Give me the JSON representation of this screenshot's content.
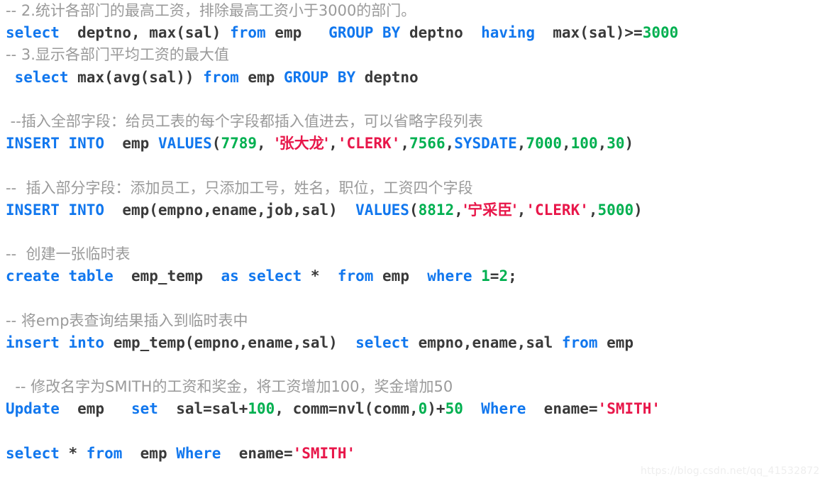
{
  "document": {
    "kind": "sql-code-snippet",
    "language": "SQL",
    "background_color": "#ffffff",
    "watermark": "https://blog.csdn.net/qq_41532872"
  },
  "colors": {
    "keyword": "#1177ee",
    "number": "#00b050",
    "string": "#e8174a",
    "comment": "#9a9a9a",
    "plain": "#3a3a3a",
    "watermark": "#eeeeee",
    "background": "#ffffff"
  },
  "lines": [
    {
      "id": "line-1",
      "type": "comment",
      "tokens": [
        {
          "t": "-- 2.统计各部门的最高工资，排除最高工资小于3000的部门。",
          "c": "cmt"
        }
      ]
    },
    {
      "id": "line-2",
      "type": "code",
      "tokens": [
        {
          "t": "select",
          "c": "kw"
        },
        {
          "t": "  deptno, max(sal) ",
          "c": "plain"
        },
        {
          "t": "from",
          "c": "kw"
        },
        {
          "t": " emp   ",
          "c": "plain"
        },
        {
          "t": "GROUP BY",
          "c": "kw"
        },
        {
          "t": " deptno  ",
          "c": "plain"
        },
        {
          "t": "having",
          "c": "kw"
        },
        {
          "t": "  max(sal)>=",
          "c": "plain"
        },
        {
          "t": "3000",
          "c": "num"
        }
      ]
    },
    {
      "id": "line-3",
      "type": "comment",
      "tokens": [
        {
          "t": "-- 3.显示各部门平均工资的最大值",
          "c": "cmt"
        }
      ]
    },
    {
      "id": "line-4",
      "type": "code",
      "tokens": [
        {
          "t": " ",
          "c": "plain"
        },
        {
          "t": "select",
          "c": "kw"
        },
        {
          "t": " max(avg(sal)) ",
          "c": "plain"
        },
        {
          "t": "from",
          "c": "kw"
        },
        {
          "t": " emp ",
          "c": "plain"
        },
        {
          "t": "GROUP BY",
          "c": "kw"
        },
        {
          "t": " deptno",
          "c": "plain"
        }
      ]
    },
    {
      "id": "line-5",
      "type": "blank",
      "tokens": []
    },
    {
      "id": "line-6",
      "type": "comment",
      "tokens": [
        {
          "t": " --插入全部字段：给员工表的每个字段都插入值进去，可以省略字段列表",
          "c": "cmt"
        }
      ]
    },
    {
      "id": "line-7",
      "type": "code",
      "tokens": [
        {
          "t": "INSERT INTO",
          "c": "kw"
        },
        {
          "t": "  emp ",
          "c": "plain"
        },
        {
          "t": "VALUES",
          "c": "kw"
        },
        {
          "t": "(",
          "c": "plain"
        },
        {
          "t": "7789",
          "c": "num"
        },
        {
          "t": ", ",
          "c": "plain"
        },
        {
          "t": "'张大龙'",
          "c": "str"
        },
        {
          "t": ",",
          "c": "plain"
        },
        {
          "t": "'CLERK'",
          "c": "str"
        },
        {
          "t": ",",
          "c": "plain"
        },
        {
          "t": "7566",
          "c": "num"
        },
        {
          "t": ",",
          "c": "plain"
        },
        {
          "t": "SYSDATE",
          "c": "kw"
        },
        {
          "t": ",",
          "c": "plain"
        },
        {
          "t": "7000",
          "c": "num"
        },
        {
          "t": ",",
          "c": "plain"
        },
        {
          "t": "100",
          "c": "num"
        },
        {
          "t": ",",
          "c": "plain"
        },
        {
          "t": "30",
          "c": "num"
        },
        {
          "t": ")",
          "c": "plain"
        }
      ]
    },
    {
      "id": "line-8",
      "type": "blank",
      "tokens": []
    },
    {
      "id": "line-9",
      "type": "comment",
      "tokens": [
        {
          "t": "--  插入部分字段：添加员工，只添加工号，姓名，职位，工资四个字段",
          "c": "cmt"
        }
      ]
    },
    {
      "id": "line-10",
      "type": "code",
      "tokens": [
        {
          "t": "INSERT INTO",
          "c": "kw"
        },
        {
          "t": "  emp(empno,ename,job,sal)  ",
          "c": "plain"
        },
        {
          "t": "VALUES",
          "c": "kw"
        },
        {
          "t": "(",
          "c": "plain"
        },
        {
          "t": "8812",
          "c": "num"
        },
        {
          "t": ",",
          "c": "plain"
        },
        {
          "t": "'宁采臣'",
          "c": "str"
        },
        {
          "t": ",",
          "c": "plain"
        },
        {
          "t": "'CLERK'",
          "c": "str"
        },
        {
          "t": ",",
          "c": "plain"
        },
        {
          "t": "5000",
          "c": "num"
        },
        {
          "t": ")",
          "c": "plain"
        }
      ]
    },
    {
      "id": "line-11",
      "type": "blank",
      "tokens": []
    },
    {
      "id": "line-12",
      "type": "comment",
      "tokens": [
        {
          "t": "--  创建一张临时表",
          "c": "cmt"
        }
      ]
    },
    {
      "id": "line-13",
      "type": "code",
      "tokens": [
        {
          "t": "create table",
          "c": "kw"
        },
        {
          "t": "  emp_temp  ",
          "c": "plain"
        },
        {
          "t": "as select",
          "c": "kw"
        },
        {
          "t": " *  ",
          "c": "plain"
        },
        {
          "t": "from",
          "c": "kw"
        },
        {
          "t": " emp  ",
          "c": "plain"
        },
        {
          "t": "where",
          "c": "kw"
        },
        {
          "t": " ",
          "c": "plain"
        },
        {
          "t": "1",
          "c": "num"
        },
        {
          "t": "=",
          "c": "plain"
        },
        {
          "t": "2",
          "c": "num"
        },
        {
          "t": ";",
          "c": "plain"
        }
      ]
    },
    {
      "id": "line-14",
      "type": "blank",
      "tokens": []
    },
    {
      "id": "line-15",
      "type": "comment",
      "tokens": [
        {
          "t": "-- 将emp表查询结果插入到临时表中",
          "c": "cmt"
        }
      ]
    },
    {
      "id": "line-16",
      "type": "code",
      "tokens": [
        {
          "t": "insert into",
          "c": "kw"
        },
        {
          "t": " emp_temp(empno,ename,sal)  ",
          "c": "plain"
        },
        {
          "t": "select",
          "c": "kw"
        },
        {
          "t": " empno,ename,sal ",
          "c": "plain"
        },
        {
          "t": "from",
          "c": "kw"
        },
        {
          "t": " emp",
          "c": "plain"
        }
      ]
    },
    {
      "id": "line-17",
      "type": "blank",
      "tokens": []
    },
    {
      "id": "line-18",
      "type": "comment",
      "tokens": [
        {
          "t": "  -- 修改名字为SMITH的工资和奖金，将工资增加100，奖金增加50",
          "c": "cmt"
        }
      ]
    },
    {
      "id": "line-19",
      "type": "code",
      "tokens": [
        {
          "t": "Update",
          "c": "kw"
        },
        {
          "t": "  emp   ",
          "c": "plain"
        },
        {
          "t": "set",
          "c": "kw"
        },
        {
          "t": "  sal=sal+",
          "c": "plain"
        },
        {
          "t": "100",
          "c": "num"
        },
        {
          "t": ", comm=nvl(comm,",
          "c": "plain"
        },
        {
          "t": "0",
          "c": "num"
        },
        {
          "t": ")+",
          "c": "plain"
        },
        {
          "t": "50",
          "c": "num"
        },
        {
          "t": "  ",
          "c": "plain"
        },
        {
          "t": "Where",
          "c": "kw"
        },
        {
          "t": "  ename=",
          "c": "plain"
        },
        {
          "t": "'SMITH'",
          "c": "str"
        }
      ]
    },
    {
      "id": "line-20",
      "type": "blank",
      "tokens": []
    },
    {
      "id": "line-21",
      "type": "code",
      "tokens": [
        {
          "t": "select",
          "c": "kw"
        },
        {
          "t": " * ",
          "c": "plain"
        },
        {
          "t": "from",
          "c": "kw"
        },
        {
          "t": "  emp ",
          "c": "plain"
        },
        {
          "t": "Where",
          "c": "kw"
        },
        {
          "t": "  ename=",
          "c": "plain"
        },
        {
          "t": "'SMITH'",
          "c": "str"
        }
      ]
    }
  ]
}
